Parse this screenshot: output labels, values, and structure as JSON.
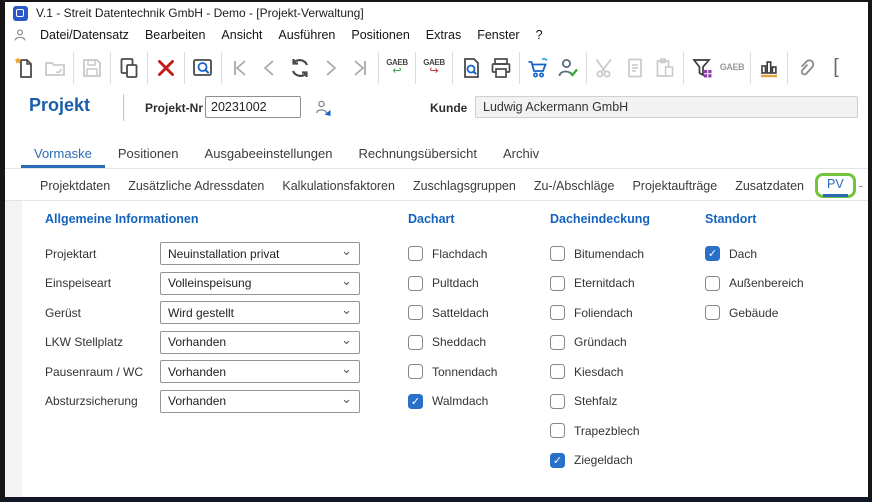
{
  "window": {
    "title": "V.1 - Streit Datentechnik GmbH - Demo - [Projekt-Verwaltung]"
  },
  "menu": {
    "items": [
      "Datei/Datensatz",
      "Bearbeiten",
      "Ansicht",
      "Ausführen",
      "Positionen",
      "Extras",
      "Fenster",
      "?"
    ]
  },
  "toolbar": {
    "gaeb_label": "GAEB",
    "icons": [
      "new-record",
      "open-record",
      "save",
      "copy-record",
      "delete-record",
      "search-record",
      "first-record",
      "previous-record",
      "refresh",
      "next-record",
      "last-record",
      "gaeb-import",
      "gaeb-export",
      "print-preview",
      "print",
      "order-sync",
      "customer-check",
      "cut",
      "copy-document",
      "paste",
      "filter",
      "gaeb",
      "statistics",
      "attachment"
    ]
  },
  "header": {
    "title": "Projekt",
    "projekt_nr_label": "Projekt-Nr",
    "projekt_nr_value": "20231002",
    "kunde_label": "Kunde",
    "kunde_value": "Ludwig Ackermann GmbH"
  },
  "main_tabs": {
    "items": [
      {
        "label": "Vormaske",
        "selected": true
      },
      {
        "label": "Positionen",
        "selected": false
      },
      {
        "label": "Ausgabeeinstellungen",
        "selected": false
      },
      {
        "label": "Rechnungsübersicht",
        "selected": false
      },
      {
        "label": "Archiv",
        "selected": false
      }
    ]
  },
  "sub_tabs": {
    "overflow_indicator": "-",
    "items": [
      {
        "label": "Projektdaten",
        "selected": false
      },
      {
        "label": "Zusätzliche Adressdaten",
        "selected": false
      },
      {
        "label": "Kalkulationsfaktoren",
        "selected": false
      },
      {
        "label": "Zuschlagsgruppen",
        "selected": false
      },
      {
        "label": "Zu-/Abschläge",
        "selected": false
      },
      {
        "label": "Projektaufträge",
        "selected": false
      },
      {
        "label": "Zusatzdaten",
        "selected": false
      },
      {
        "label": "PV",
        "selected": true,
        "highlighted": true
      }
    ]
  },
  "form": {
    "heading": "Allgemeine Informationen",
    "rows": [
      {
        "label": "Projektart",
        "value": "Neuinstallation privat"
      },
      {
        "label": "Einspeiseart",
        "value": "Volleinspeisung"
      },
      {
        "label": "Gerüst",
        "value": "Wird gestellt"
      },
      {
        "label": "LKW Stellplatz",
        "value": "Vorhanden"
      },
      {
        "label": "Pausenraum / WC",
        "value": "Vorhanden"
      },
      {
        "label": "Absturzsicherung",
        "value": "Vorhanden"
      }
    ]
  },
  "checkbox_groups": [
    {
      "heading": "Dachart",
      "options": [
        {
          "label": "Flachdach",
          "checked": false
        },
        {
          "label": "Pultdach",
          "checked": false
        },
        {
          "label": "Satteldach",
          "checked": false
        },
        {
          "label": "Sheddach",
          "checked": false
        },
        {
          "label": "Tonnendach",
          "checked": false
        },
        {
          "label": "Walmdach",
          "checked": true
        }
      ]
    },
    {
      "heading": "Dacheindeckung",
      "options": [
        {
          "label": "Bitumendach",
          "checked": false
        },
        {
          "label": "Eternitdach",
          "checked": false
        },
        {
          "label": "Foliendach",
          "checked": false
        },
        {
          "label": "Gründach",
          "checked": false
        },
        {
          "label": "Kiesdach",
          "checked": false
        },
        {
          "label": "Stehfalz",
          "checked": false
        },
        {
          "label": "Trapezblech",
          "checked": false
        },
        {
          "label": "Ziegeldach",
          "checked": true
        }
      ]
    },
    {
      "heading": "Standort",
      "options": [
        {
          "label": "Dach",
          "checked": true
        },
        {
          "label": "Außenbereich",
          "checked": false
        },
        {
          "label": "Gebäude",
          "checked": false
        }
      ]
    }
  ],
  "colors": {
    "accent_blue": "#1464be",
    "tab_selected_blue": "#2a6bb5",
    "checkbox_checked_blue": "#2970c8",
    "highlight_green": "#74c33c",
    "delete_red": "#c41c1c",
    "star_orange": "#f0a028"
  }
}
